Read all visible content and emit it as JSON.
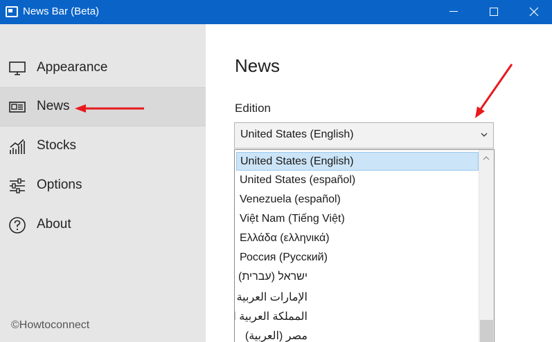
{
  "window": {
    "title": "News Bar (Beta)",
    "icons": {
      "app": "news-bar-app-icon",
      "minimize": "minimize-icon",
      "maximize": "maximize-icon",
      "close": "close-icon"
    }
  },
  "sidebar": {
    "items": [
      {
        "label": "Appearance",
        "icon": "monitor-icon"
      },
      {
        "label": "News",
        "icon": "newspaper-icon",
        "selected": true
      },
      {
        "label": "Stocks",
        "icon": "stock-chart-icon"
      },
      {
        "label": "Options",
        "icon": "sliders-icon"
      },
      {
        "label": "About",
        "icon": "help-circle-icon"
      }
    ],
    "watermark": "©Howtoconnect"
  },
  "main": {
    "title": "News",
    "edition": {
      "label": "Edition",
      "selected_value": "United States (English)",
      "options": [
        "United States (English)",
        "United States (español)",
        "Venezuela (español)",
        "Việt Nam (Tiếng Việt)",
        "Ελλάδα (ελληνικά)",
        "Россия (Русский)",
        "ישראל (עברית)",
        "الإمارات العربية المتحدة (العربية)",
        "المملكة العربية السعودية (العربية)",
        "مصر (العربية)"
      ]
    }
  },
  "colors": {
    "titlebar": "#0a64c8",
    "sidebar_bg": "#e6e6e6",
    "sidebar_selected": "#d9d9d9",
    "option_highlight": "#cce4f7",
    "annotation_arrow": "#e8191c"
  }
}
